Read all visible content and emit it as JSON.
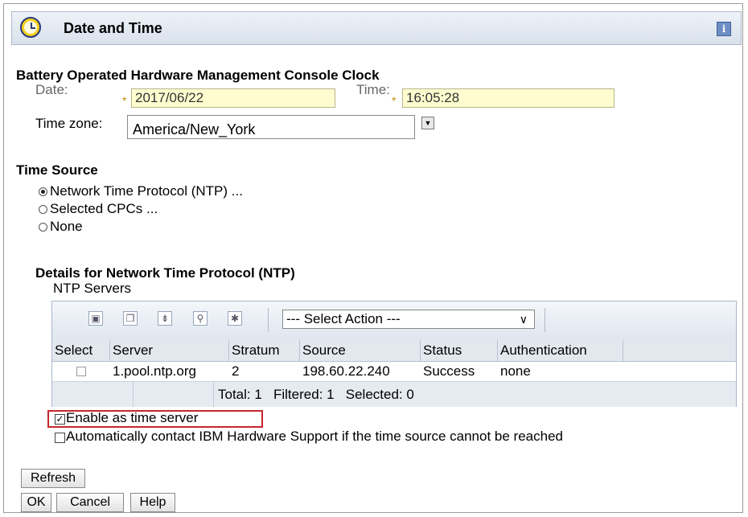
{
  "window": {
    "title": "Date and Time",
    "info_glyph": "i"
  },
  "clock_section": {
    "heading": "Battery Operated Hardware Management Console Clock",
    "date_label": "Date:",
    "date_value": "2017/06/22",
    "time_label": "Time:",
    "time_value": "16:05:28",
    "timezone_label": "Time zone:",
    "timezone_value": "America/New_York",
    "required_marker": "*"
  },
  "time_source": {
    "heading": "Time Source",
    "options": [
      {
        "label": "Network Time Protocol (NTP) ...",
        "selected": true
      },
      {
        "label": "Selected CPCs ...",
        "selected": false
      },
      {
        "label": "None",
        "selected": false
      }
    ]
  },
  "ntp": {
    "heading": "Details for Network Time Protocol (NTP)",
    "servers_label": "NTP Servers",
    "toolbar_icons": [
      "select-all-icon",
      "deselect-all-icon",
      "filter-icon",
      "clear-filter-icon",
      "configure-columns-icon"
    ],
    "select_action": "--- Select Action ---",
    "columns": [
      "Select",
      "Server",
      "Stratum",
      "Source",
      "Status",
      "Authentication"
    ],
    "rows": [
      {
        "server": "1.pool.ntp.org",
        "stratum": "2",
        "source": "198.60.22.240",
        "status": "Success",
        "authentication": "none"
      }
    ],
    "footer": {
      "total": "Total: 1",
      "filtered": "Filtered: 1",
      "selected": "Selected: 0"
    }
  },
  "options": {
    "enable_time_server": {
      "label": "Enable as time server",
      "checked": true
    },
    "auto_contact": {
      "label": "Automatically contact IBM Hardware Support if the time source cannot be reached",
      "checked": false
    }
  },
  "buttons": {
    "refresh": "Refresh",
    "ok": "OK",
    "cancel": "Cancel",
    "help": "Help"
  },
  "colors": {
    "required_field_bg": "#fffdcf",
    "highlight_border": "#c6262e",
    "titlebar": "#d9e1ec"
  }
}
